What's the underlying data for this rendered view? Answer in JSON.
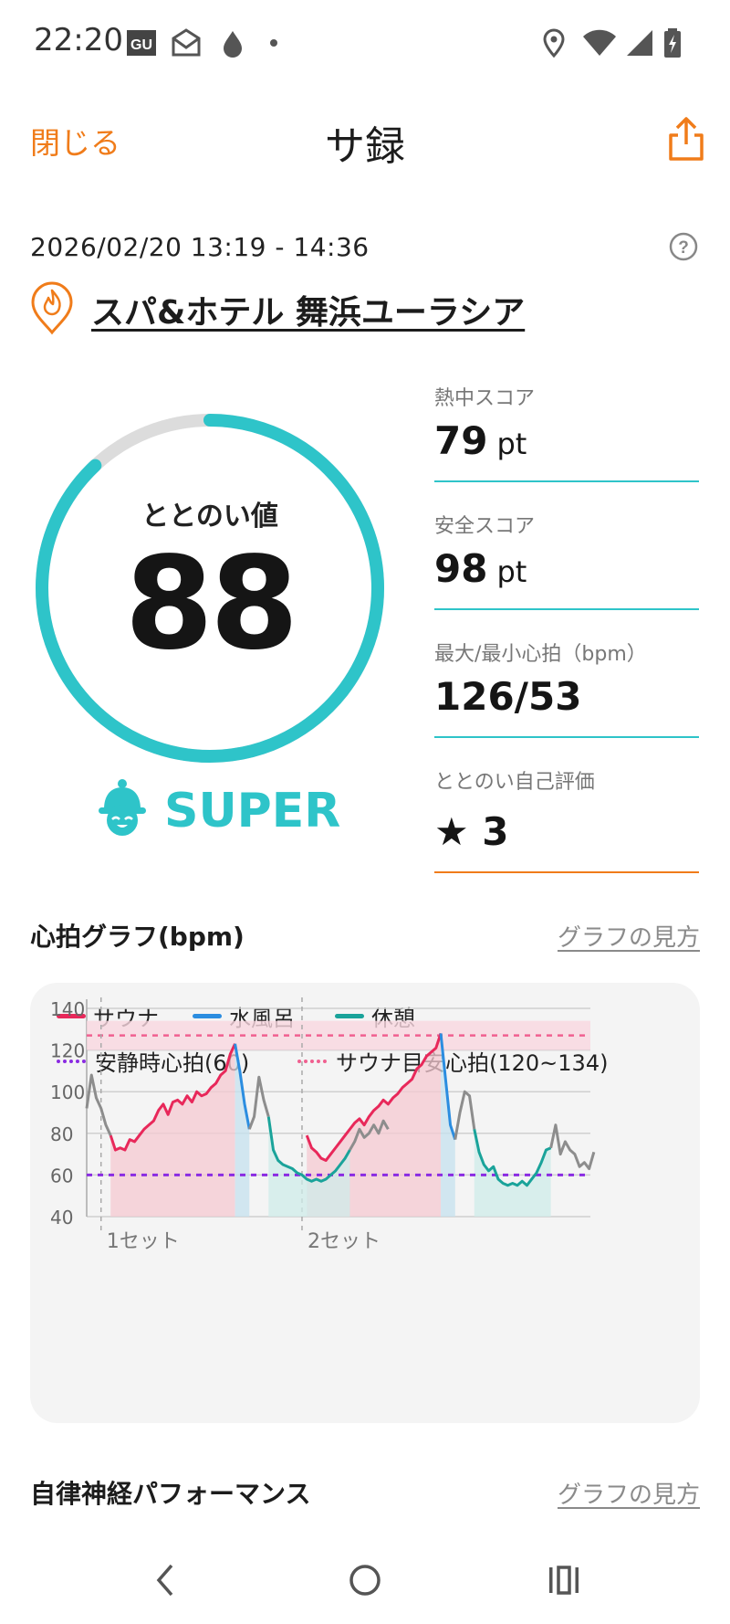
{
  "status_bar": {
    "time": "22:20",
    "icons": [
      "gu-icon",
      "mail-icon",
      "drop-icon",
      "dot-icon",
      "location-icon",
      "wifi-icon",
      "signal-icon",
      "battery-charging-icon"
    ]
  },
  "header": {
    "close_label": "閉じる",
    "title": "サ録",
    "share_icon": "share-icon"
  },
  "session": {
    "datetime": "2026/02/20 13:19 - 14:36",
    "facility": "スパ&ホテル 舞浜ユーラシア"
  },
  "score": {
    "label": "ととのい値",
    "value": "88",
    "fraction": 0.88,
    "rank": "SUPER"
  },
  "metrics": [
    {
      "label": "熱中スコア",
      "value": "79",
      "unit": "pt"
    },
    {
      "label": "安全スコア",
      "value": "98",
      "unit": "pt"
    },
    {
      "label": "最大/最小心拍（bpm）",
      "value": "126/53",
      "unit": ""
    },
    {
      "label": "ととのい自己評価",
      "value": "★ 3",
      "unit": ""
    }
  ],
  "heart_section": {
    "title": "心拍グラフ(bpm)",
    "help_link": "グラフの見方"
  },
  "autonomic_section": {
    "title": "自律神経パフォーマンス",
    "help_link": "グラフの見方"
  },
  "colors": {
    "accent": "#f07c1a",
    "teal": "#2ec4c9",
    "sauna": "#e8285a",
    "water": "#2b8de0",
    "rest": "#1aa39a",
    "resting_line": "#8a2be2",
    "target_line": "#f06090"
  },
  "chart_data": {
    "type": "line",
    "legend": {
      "sauna": "サウナ",
      "water": "水風呂",
      "rest": "休憩",
      "resting": "安静時心拍(60)",
      "target": "サウナ目安心拍(120~134)"
    },
    "ylim": [
      40,
      140
    ],
    "y_ticks": [
      "140",
      "120",
      "100",
      "80",
      "60",
      "40"
    ],
    "resting_hr": 60,
    "target_band": [
      120,
      134
    ],
    "target_line": 127,
    "set_labels": [
      "1セット",
      "2セット"
    ],
    "series": [
      {
        "name": "サウナ",
        "segments": [
          [
            [
              0.05,
              79
            ],
            [
              0.06,
              72
            ],
            [
              0.07,
              73
            ],
            [
              0.08,
              72
            ],
            [
              0.09,
              77
            ],
            [
              0.1,
              76
            ],
            [
              0.11,
              79
            ],
            [
              0.12,
              82
            ],
            [
              0.13,
              84
            ],
            [
              0.14,
              86
            ],
            [
              0.15,
              91
            ],
            [
              0.16,
              94
            ],
            [
              0.17,
              89
            ],
            [
              0.18,
              95
            ],
            [
              0.19,
              96
            ],
            [
              0.2,
              94
            ],
            [
              0.21,
              98
            ],
            [
              0.22,
              95
            ],
            [
              0.23,
              100
            ],
            [
              0.24,
              98
            ],
            [
              0.25,
              99
            ],
            [
              0.26,
              102
            ],
            [
              0.27,
              104
            ],
            [
              0.28,
              108
            ],
            [
              0.29,
              110
            ],
            [
              0.3,
              118
            ],
            [
              0.31,
              123
            ]
          ],
          [
            [
              0.46,
              79
            ],
            [
              0.47,
              73
            ],
            [
              0.48,
              71
            ],
            [
              0.49,
              68
            ],
            [
              0.5,
              67
            ],
            [
              0.51,
              70
            ],
            [
              0.52,
              73
            ],
            [
              0.53,
              76
            ],
            [
              0.54,
              79
            ],
            [
              0.55,
              82
            ],
            [
              0.56,
              85
            ],
            [
              0.57,
              87
            ],
            [
              0.58,
              84
            ],
            [
              0.59,
              88
            ],
            [
              0.6,
              91
            ],
            [
              0.61,
              93
            ],
            [
              0.62,
              96
            ],
            [
              0.63,
              94
            ],
            [
              0.64,
              97
            ],
            [
              0.65,
              99
            ],
            [
              0.66,
              102
            ],
            [
              0.67,
              104
            ],
            [
              0.68,
              106
            ],
            [
              0.69,
              111
            ],
            [
              0.7,
              113
            ],
            [
              0.71,
              117
            ],
            [
              0.72,
              119
            ],
            [
              0.73,
              121
            ],
            [
              0.74,
              128
            ]
          ]
        ]
      },
      {
        "name": "水風呂",
        "segments": [
          [
            [
              0.31,
              123
            ],
            [
              0.32,
              110
            ],
            [
              0.33,
              94
            ],
            [
              0.34,
              82
            ]
          ],
          [
            [
              0.74,
              128
            ],
            [
              0.75,
              106
            ],
            [
              0.76,
              84
            ],
            [
              0.77,
              77
            ]
          ]
        ]
      },
      {
        "name": "休憩",
        "segments": [
          [
            [
              0.38,
              88
            ],
            [
              0.39,
              72
            ],
            [
              0.4,
              67
            ],
            [
              0.41,
              65
            ],
            [
              0.42,
              64
            ],
            [
              0.43,
              63
            ],
            [
              0.44,
              61
            ],
            [
              0.45,
              60
            ],
            [
              0.46,
              58
            ],
            [
              0.47,
              57
            ],
            [
              0.48,
              58
            ],
            [
              0.49,
              57
            ],
            [
              0.5,
              58
            ],
            [
              0.51,
              60
            ],
            [
              0.52,
              62
            ],
            [
              0.53,
              65
            ],
            [
              0.54,
              68
            ],
            [
              0.55,
              72
            ]
          ],
          [
            [
              0.81,
              82
            ],
            [
              0.82,
              71
            ],
            [
              0.83,
              65
            ],
            [
              0.84,
              62
            ],
            [
              0.85,
              64
            ],
            [
              0.86,
              58
            ],
            [
              0.87,
              56
            ],
            [
              0.88,
              55
            ],
            [
              0.89,
              56
            ],
            [
              0.9,
              55
            ],
            [
              0.91,
              57
            ],
            [
              0.92,
              55
            ],
            [
              0.93,
              58
            ],
            [
              0.94,
              61
            ],
            [
              0.95,
              66
            ],
            [
              0.96,
              72
            ],
            [
              0.97,
              73
            ]
          ]
        ]
      },
      {
        "name": "other",
        "segments": [
          [
            [
              0.0,
              92
            ],
            [
              0.01,
              108
            ],
            [
              0.02,
              97
            ],
            [
              0.03,
              92
            ],
            [
              0.04,
              84
            ],
            [
              0.05,
              79
            ]
          ],
          [
            [
              0.34,
              82
            ],
            [
              0.35,
              88
            ],
            [
              0.36,
              107
            ],
            [
              0.37,
              96
            ],
            [
              0.38,
              88
            ]
          ],
          [
            [
              0.55,
              72
            ],
            [
              0.56,
              76
            ],
            [
              0.57,
              82
            ],
            [
              0.58,
              78
            ],
            [
              0.59,
              80
            ],
            [
              0.6,
              84
            ],
            [
              0.61,
              80
            ],
            [
              0.62,
              86
            ],
            [
              0.63,
              82
            ]
          ],
          [
            [
              0.77,
              77
            ],
            [
              0.78,
              90
            ],
            [
              0.79,
              100
            ],
            [
              0.8,
              98
            ],
            [
              0.81,
              82
            ]
          ],
          [
            [
              0.97,
              73
            ],
            [
              0.98,
              84
            ],
            [
              0.99,
              70
            ],
            [
              1.0,
              76
            ],
            [
              1.01,
              72
            ],
            [
              1.02,
              70
            ],
            [
              1.03,
              64
            ],
            [
              1.04,
              66
            ],
            [
              1.05,
              63
            ],
            [
              1.06,
              71
            ]
          ]
        ]
      }
    ]
  },
  "nav": {
    "back": "back-icon",
    "home": "home-icon",
    "recents": "recents-icon"
  }
}
